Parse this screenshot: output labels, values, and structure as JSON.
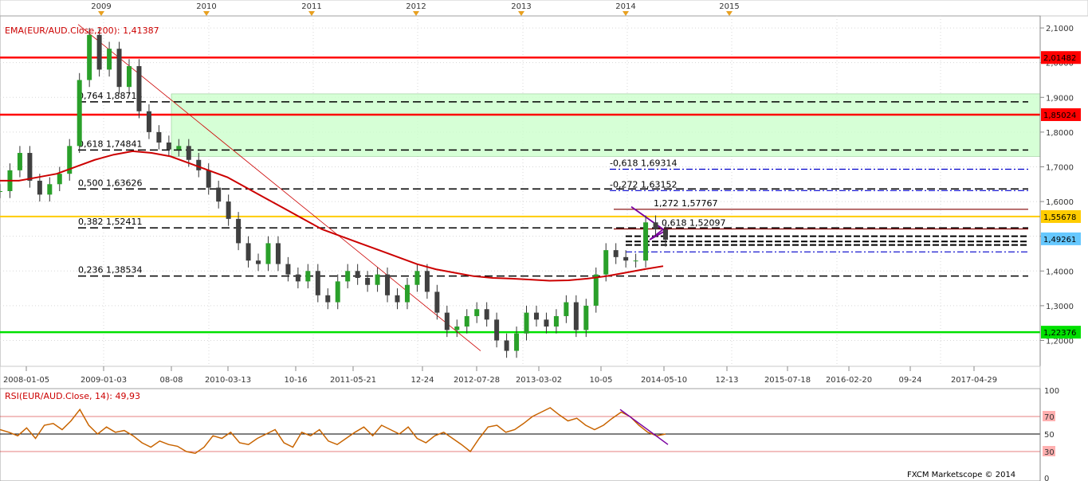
{
  "colors": {
    "ema": "#cc0000",
    "resistance": "#ff0000",
    "support": "#00e000",
    "pivot": "#ffcc00",
    "fib_zone": "#ccffcc",
    "rsi": "#c86400",
    "current": "#66c8ff",
    "ext": "#0000cc"
  },
  "chart_data": [
    {
      "type": "line",
      "indicator_label": "EMA(EUR/AUD.Close,200): 1,41387",
      "year_labels": [
        "2009",
        "2010",
        "2011",
        "2012",
        "2013",
        "2014",
        "2015"
      ],
      "x_tick_labels": [
        "2008-01-05",
        "2009-01-03",
        "08-08",
        "2010-03-13",
        "10-16",
        "2011-05-21",
        "12-24",
        "2012-07-28",
        "2013-03-02",
        "10-05",
        "2014-05-10",
        "12-13",
        "2015-07-18",
        "2016-02-20",
        "09-24",
        "2017-04-29"
      ],
      "y_tick_labels": [
        "2,1000",
        "2,0000",
        "1,9000",
        "1,8000",
        "1,7000",
        "1,6000",
        "1,5000",
        "1,4000",
        "1,3000",
        "1,2000"
      ],
      "ylim": [
        1.13,
        2.13
      ],
      "price_badges": [
        {
          "label": "2,01482",
          "value": 2.01482,
          "color": "#ff0000"
        },
        {
          "label": "1,85024",
          "value": 1.85024,
          "color": "#ff0000"
        },
        {
          "label": "1,55678",
          "value": 1.55678,
          "color": "#ffcc00"
        },
        {
          "label": "1,49261",
          "value": 1.49261,
          "color": "#66c8ff"
        },
        {
          "label": "1,22376",
          "value": 1.22376,
          "color": "#00e000"
        }
      ],
      "horizontal_levels": [
        {
          "value": 2.01482,
          "style": "solid",
          "color": "#ff0000"
        },
        {
          "value": 1.85024,
          "style": "solid",
          "color": "#ff0000"
        },
        {
          "value": 1.55678,
          "style": "solid",
          "color": "#ffcc00"
        },
        {
          "value": 1.22376,
          "style": "solid",
          "color": "#00e000"
        }
      ],
      "fib_retracements": [
        {
          "label": "0,764 1,88718",
          "value": 1.88718
        },
        {
          "label": "0,618 1,74841",
          "value": 1.74841
        },
        {
          "label": "0,500 1,63626",
          "value": 1.63626
        },
        {
          "label": "0,382 1,52411",
          "value": 1.52411
        },
        {
          "label": "0,236 1,38534",
          "value": 1.38534
        }
      ],
      "fib_extensions": [
        {
          "label": "-0,618 1,69314",
          "value": 1.69314
        },
        {
          "label": "-0,272 1,63152",
          "value": 1.63152
        },
        {
          "label": "1,272 1,57767",
          "value": 1.57767
        },
        {
          "label": "0,618 1,52097",
          "value": 1.52097
        }
      ],
      "fib_zone": [
        1.73,
        1.91
      ],
      "close_series": [
        1.63,
        1.69,
        1.74,
        1.66,
        1.62,
        1.65,
        1.68,
        1.76,
        1.95,
        2.08,
        1.98,
        2.04,
        1.93,
        1.99,
        1.86,
        1.8,
        1.77,
        1.75,
        1.76,
        1.72,
        1.69,
        1.64,
        1.6,
        1.55,
        1.48,
        1.43,
        1.42,
        1.48,
        1.42,
        1.39,
        1.37,
        1.4,
        1.33,
        1.31,
        1.37,
        1.4,
        1.38,
        1.36,
        1.39,
        1.33,
        1.31,
        1.36,
        1.4,
        1.34,
        1.28,
        1.23,
        1.24,
        1.27,
        1.29,
        1.26,
        1.2,
        1.17,
        1.22,
        1.28,
        1.26,
        1.24,
        1.27,
        1.31,
        1.23,
        1.3,
        1.39,
        1.46,
        1.44,
        1.43,
        1.43,
        1.54,
        1.52,
        1.49
      ],
      "ema_series": [
        1.66,
        1.66,
        1.67,
        1.68,
        1.7,
        1.72,
        1.735,
        1.745,
        1.74,
        1.73,
        1.71,
        1.69,
        1.67,
        1.64,
        1.61,
        1.58,
        1.55,
        1.52,
        1.5,
        1.48,
        1.46,
        1.44,
        1.42,
        1.405,
        1.395,
        1.385,
        1.38,
        1.378,
        1.375,
        1.372,
        1.373,
        1.378,
        1.385,
        1.395,
        1.405,
        1.414
      ]
    },
    {
      "type": "line",
      "indicator_label": "RSI(EUR/AUD.Close, 14): 49,93",
      "y_tick_labels": [
        "100",
        "70",
        "50",
        "30",
        "0"
      ],
      "ylim": [
        0,
        100
      ],
      "levels": [
        70,
        50,
        30
      ],
      "rsi_series": [
        55,
        52,
        48,
        57,
        45,
        60,
        62,
        55,
        65,
        78,
        60,
        50,
        58,
        52,
        54,
        48,
        40,
        35,
        42,
        38,
        36,
        30,
        28,
        35,
        48,
        45,
        52,
        40,
        38,
        45,
        50,
        55,
        40,
        35,
        52,
        48,
        55,
        42,
        38,
        45,
        52,
        58,
        48,
        60,
        55,
        50,
        58,
        45,
        40,
        48,
        52,
        45,
        38,
        30,
        45,
        58,
        60,
        52,
        55,
        62,
        70,
        75,
        80,
        72,
        65,
        68,
        60,
        55,
        60,
        68,
        75,
        70,
        60,
        52,
        48,
        50
      ]
    }
  ],
  "watermark": "FXCM Marketscope © 2014"
}
